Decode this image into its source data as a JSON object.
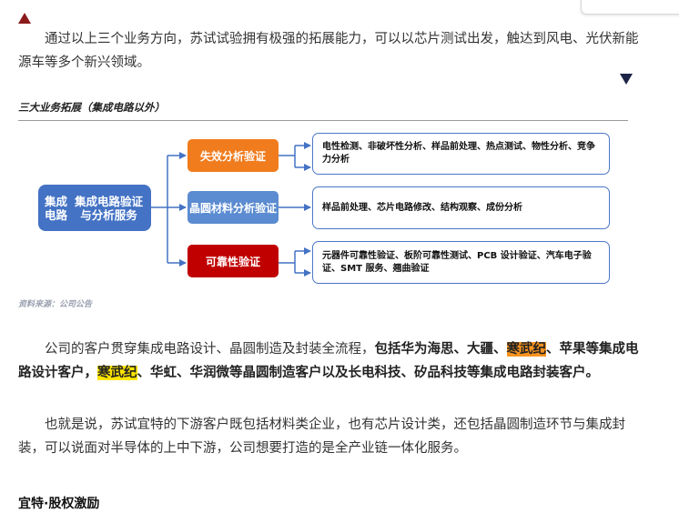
{
  "paragraph1": "通过以上三个业务方向，苏试试验拥有极强的拓展能力，可以以芯片测试出发，触达到风电、光伏新能源车等多个新兴领域。",
  "figure": {
    "title": "三大业务拓展（集成电路以外）",
    "main_node": "集成电路集成电路验证与分析服务",
    "categories": [
      {
        "label": "失效分析验证",
        "detail": "电性检测、非破坏性分析、样品前处理、热点测试、物性分析、竞争力分析",
        "color": "#f07c1e"
      },
      {
        "label": "晶圆材料分析验证",
        "detail": "样品前处理、芯片电路修改、结构观察、成份分析",
        "color": "#5b8bd0"
      },
      {
        "label": "可靠性验证",
        "detail": "元器件可靠性验证、板阶可靠性测试、PCB 设计验证、汽车电子验证、SMT 服务、翘曲验证",
        "color": "#c00000"
      }
    ],
    "source": "资料来源：公司公告",
    "accent_color": "#4472c4"
  },
  "paragraph2": {
    "plain1": "公司的客户贯穿集成电路设计、晶圆制造及封装全流程，",
    "bold1": "包括华为海思、大疆、",
    "hl1": "寒武纪",
    "bold2": "、苹果等集成电路设计客户，",
    "hl2": "寒武纪",
    "bold3": "、华虹、华润微等晶圆制造客户以及长电科技、矽品科技等集成电路封装客户。"
  },
  "paragraph3": "也就是说，苏试宜特的下游客户既包括材料类企业，也有芯片设计类，还包括晶圆制造环节与集成封装，可以说面对半导体的上中下游，公司想要打造的是全产业链一体化服务。",
  "subheading": "宜特·股权激励"
}
